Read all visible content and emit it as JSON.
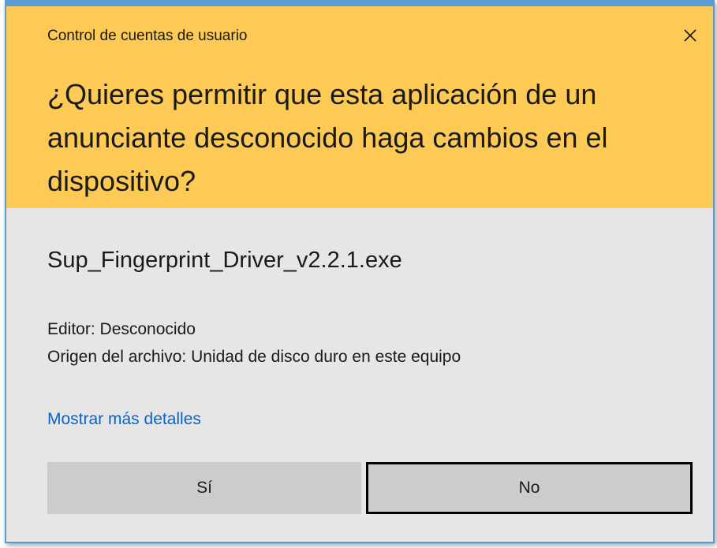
{
  "dialog": {
    "title": "Control de cuentas de usuario",
    "question": "¿Quieres permitir que esta aplicación de un anunciante desconocido haga cambios en el dispositivo?",
    "header_color": "#fdcb55",
    "close_icon": "close-icon"
  },
  "app": {
    "filename": "Sup_Fingerprint_Driver_v2.2.1.exe",
    "editor": "Editor: Desconocido",
    "origin": "Origen del archivo: Unidad de disco duro en este equipo"
  },
  "details_link": "Mostrar más detalles",
  "link_color": "#0a64c8",
  "buttons": {
    "yes_label": "Sí",
    "no_label": "No"
  }
}
